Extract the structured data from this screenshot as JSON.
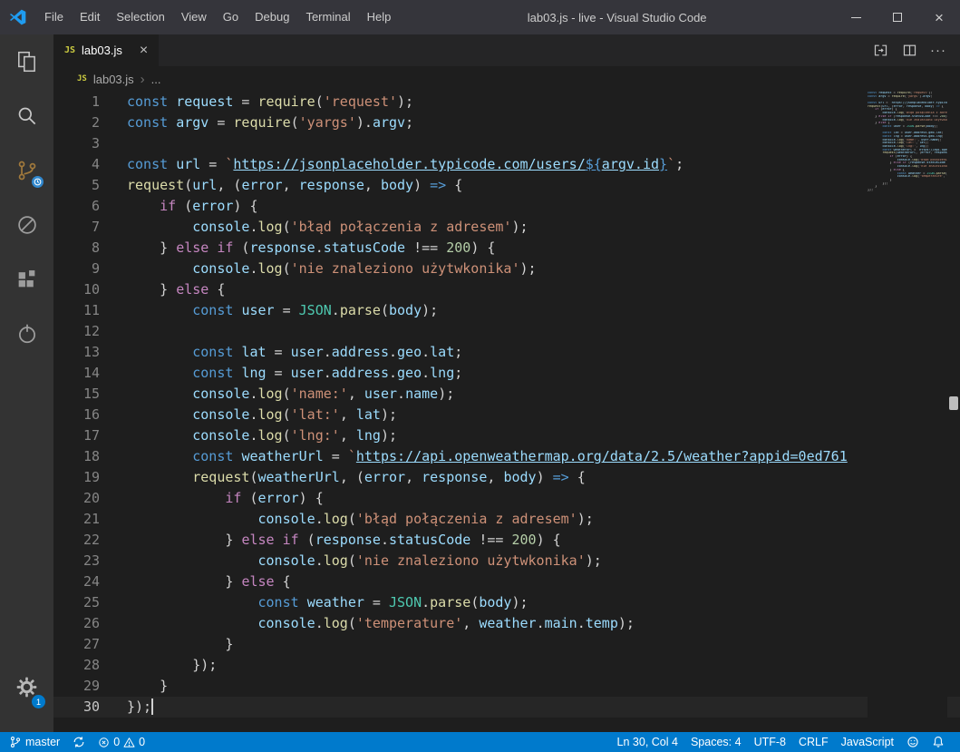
{
  "window": {
    "title": "lab03.js - live - Visual Studio Code",
    "menus": [
      "File",
      "Edit",
      "Selection",
      "View",
      "Go",
      "Debug",
      "Terminal",
      "Help"
    ],
    "close_glyph": "×"
  },
  "activity_bar": {
    "items": [
      "explorer",
      "search",
      "source-control",
      "debug",
      "extensions",
      "extension"
    ],
    "settings_badge": "1"
  },
  "tabs": [
    {
      "icon": "JS",
      "label": "lab03.js",
      "close": "×",
      "active": true
    }
  ],
  "editor_actions": {
    "more": "···"
  },
  "breadcrumb": {
    "icon": "JS",
    "file": "lab03.js",
    "separator": "›",
    "symbol": "..."
  },
  "editor": {
    "cursor": {
      "line": 30,
      "col": 4
    },
    "lines": [
      [
        [
          "kw",
          "const"
        ],
        [
          "pl",
          " "
        ],
        [
          "var",
          "request"
        ],
        [
          "pl",
          " = "
        ],
        [
          "fn",
          "require"
        ],
        [
          "pl",
          "("
        ],
        [
          "str",
          "'request'"
        ],
        [
          "pl",
          ");"
        ]
      ],
      [
        [
          "kw",
          "const"
        ],
        [
          "pl",
          " "
        ],
        [
          "var",
          "argv"
        ],
        [
          "pl",
          " = "
        ],
        [
          "fn",
          "require"
        ],
        [
          "pl",
          "("
        ],
        [
          "str",
          "'yargs'"
        ],
        [
          "pl",
          ")."
        ],
        [
          "var",
          "argv"
        ],
        [
          "pl",
          ";"
        ]
      ],
      [],
      [
        [
          "kw",
          "const"
        ],
        [
          "pl",
          " "
        ],
        [
          "var",
          "url"
        ],
        [
          "pl",
          " = "
        ],
        [
          "str",
          "`"
        ],
        [
          "link u",
          "https://jsonplaceholder.typicode.com/users/"
        ],
        [
          "kw u",
          "${"
        ],
        [
          "var u",
          "argv.id"
        ],
        [
          "kw u",
          "}"
        ],
        [
          "str",
          "`"
        ],
        [
          "pl",
          ";"
        ]
      ],
      [
        [
          "fn",
          "request"
        ],
        [
          "pl",
          "("
        ],
        [
          "var",
          "url"
        ],
        [
          "pl",
          ", ("
        ],
        [
          "var",
          "error"
        ],
        [
          "pl",
          ", "
        ],
        [
          "var",
          "response"
        ],
        [
          "pl",
          ", "
        ],
        [
          "var",
          "body"
        ],
        [
          "pl",
          ") "
        ],
        [
          "kw",
          "=>"
        ],
        [
          "pl",
          " {"
        ]
      ],
      [
        [
          "pl",
          "    "
        ],
        [
          "ctrl",
          "if"
        ],
        [
          "pl",
          " ("
        ],
        [
          "var",
          "error"
        ],
        [
          "pl",
          ") {"
        ]
      ],
      [
        [
          "pl",
          "        "
        ],
        [
          "var",
          "console"
        ],
        [
          "pl",
          "."
        ],
        [
          "fn",
          "log"
        ],
        [
          "pl",
          "("
        ],
        [
          "str",
          "'błąd połączenia z adresem'"
        ],
        [
          "pl",
          ");"
        ]
      ],
      [
        [
          "pl",
          "    } "
        ],
        [
          "ctrl",
          "else"
        ],
        [
          "pl",
          " "
        ],
        [
          "ctrl",
          "if"
        ],
        [
          "pl",
          " ("
        ],
        [
          "var",
          "response"
        ],
        [
          "pl",
          "."
        ],
        [
          "var",
          "statusCode"
        ],
        [
          "pl",
          " !== "
        ],
        [
          "num",
          "200"
        ],
        [
          "pl",
          ") {"
        ]
      ],
      [
        [
          "pl",
          "        "
        ],
        [
          "var",
          "console"
        ],
        [
          "pl",
          "."
        ],
        [
          "fn",
          "log"
        ],
        [
          "pl",
          "("
        ],
        [
          "str",
          "'nie znaleziono użytwkonika'"
        ],
        [
          "pl",
          ");"
        ]
      ],
      [
        [
          "pl",
          "    } "
        ],
        [
          "ctrl",
          "else"
        ],
        [
          "pl",
          " {"
        ]
      ],
      [
        [
          "pl",
          "        "
        ],
        [
          "kw",
          "const"
        ],
        [
          "pl",
          " "
        ],
        [
          "var",
          "user"
        ],
        [
          "pl",
          " = "
        ],
        [
          "cls",
          "JSON"
        ],
        [
          "pl",
          "."
        ],
        [
          "fn",
          "parse"
        ],
        [
          "pl",
          "("
        ],
        [
          "var",
          "body"
        ],
        [
          "pl",
          ");"
        ]
      ],
      [],
      [
        [
          "pl",
          "        "
        ],
        [
          "kw",
          "const"
        ],
        [
          "pl",
          " "
        ],
        [
          "var",
          "lat"
        ],
        [
          "pl",
          " = "
        ],
        [
          "var",
          "user"
        ],
        [
          "pl",
          "."
        ],
        [
          "var",
          "address"
        ],
        [
          "pl",
          "."
        ],
        [
          "var",
          "geo"
        ],
        [
          "pl",
          "."
        ],
        [
          "var",
          "lat"
        ],
        [
          "pl",
          ";"
        ]
      ],
      [
        [
          "pl",
          "        "
        ],
        [
          "kw",
          "const"
        ],
        [
          "pl",
          " "
        ],
        [
          "var",
          "lng"
        ],
        [
          "pl",
          " = "
        ],
        [
          "var",
          "user"
        ],
        [
          "pl",
          "."
        ],
        [
          "var",
          "address"
        ],
        [
          "pl",
          "."
        ],
        [
          "var",
          "geo"
        ],
        [
          "pl",
          "."
        ],
        [
          "var",
          "lng"
        ],
        [
          "pl",
          ";"
        ]
      ],
      [
        [
          "pl",
          "        "
        ],
        [
          "var",
          "console"
        ],
        [
          "pl",
          "."
        ],
        [
          "fn",
          "log"
        ],
        [
          "pl",
          "("
        ],
        [
          "str",
          "'name:'"
        ],
        [
          "pl",
          ", "
        ],
        [
          "var",
          "user"
        ],
        [
          "pl",
          "."
        ],
        [
          "var",
          "name"
        ],
        [
          "pl",
          ");"
        ]
      ],
      [
        [
          "pl",
          "        "
        ],
        [
          "var",
          "console"
        ],
        [
          "pl",
          "."
        ],
        [
          "fn",
          "log"
        ],
        [
          "pl",
          "("
        ],
        [
          "str",
          "'lat:'"
        ],
        [
          "pl",
          ", "
        ],
        [
          "var",
          "lat"
        ],
        [
          "pl",
          ");"
        ]
      ],
      [
        [
          "pl",
          "        "
        ],
        [
          "var",
          "console"
        ],
        [
          "pl",
          "."
        ],
        [
          "fn",
          "log"
        ],
        [
          "pl",
          "("
        ],
        [
          "str",
          "'lng:'"
        ],
        [
          "pl",
          ", "
        ],
        [
          "var",
          "lng"
        ],
        [
          "pl",
          ");"
        ]
      ],
      [
        [
          "pl",
          "        "
        ],
        [
          "kw",
          "const"
        ],
        [
          "pl",
          " "
        ],
        [
          "var",
          "weatherUrl"
        ],
        [
          "pl",
          " = "
        ],
        [
          "str",
          "`"
        ],
        [
          "link u",
          "https://api.openweathermap.org/data/2.5/weather?appid=0ed761"
        ]
      ],
      [
        [
          "pl",
          "        "
        ],
        [
          "fn",
          "request"
        ],
        [
          "pl",
          "("
        ],
        [
          "var",
          "weatherUrl"
        ],
        [
          "pl",
          ", ("
        ],
        [
          "var",
          "error"
        ],
        [
          "pl",
          ", "
        ],
        [
          "var",
          "response"
        ],
        [
          "pl",
          ", "
        ],
        [
          "var",
          "body"
        ],
        [
          "pl",
          ") "
        ],
        [
          "kw",
          "=>"
        ],
        [
          "pl",
          " {"
        ]
      ],
      [
        [
          "pl",
          "            "
        ],
        [
          "ctrl",
          "if"
        ],
        [
          "pl",
          " ("
        ],
        [
          "var",
          "error"
        ],
        [
          "pl",
          ") {"
        ]
      ],
      [
        [
          "pl",
          "                "
        ],
        [
          "var",
          "console"
        ],
        [
          "pl",
          "."
        ],
        [
          "fn",
          "log"
        ],
        [
          "pl",
          "("
        ],
        [
          "str",
          "'błąd połączenia z adresem'"
        ],
        [
          "pl",
          ");"
        ]
      ],
      [
        [
          "pl",
          "            } "
        ],
        [
          "ctrl",
          "else"
        ],
        [
          "pl",
          " "
        ],
        [
          "ctrl",
          "if"
        ],
        [
          "pl",
          " ("
        ],
        [
          "var",
          "response"
        ],
        [
          "pl",
          "."
        ],
        [
          "var",
          "statusCode"
        ],
        [
          "pl",
          " !== "
        ],
        [
          "num",
          "200"
        ],
        [
          "pl",
          ") {"
        ]
      ],
      [
        [
          "pl",
          "                "
        ],
        [
          "var",
          "console"
        ],
        [
          "pl",
          "."
        ],
        [
          "fn",
          "log"
        ],
        [
          "pl",
          "("
        ],
        [
          "str",
          "'nie znaleziono użytwkonika'"
        ],
        [
          "pl",
          ");"
        ]
      ],
      [
        [
          "pl",
          "            } "
        ],
        [
          "ctrl",
          "else"
        ],
        [
          "pl",
          " {"
        ]
      ],
      [
        [
          "pl",
          "                "
        ],
        [
          "kw",
          "const"
        ],
        [
          "pl",
          " "
        ],
        [
          "var",
          "weather"
        ],
        [
          "pl",
          " = "
        ],
        [
          "cls",
          "JSON"
        ],
        [
          "pl",
          "."
        ],
        [
          "fn",
          "parse"
        ],
        [
          "pl",
          "("
        ],
        [
          "var",
          "body"
        ],
        [
          "pl",
          ");"
        ]
      ],
      [
        [
          "pl",
          "                "
        ],
        [
          "var",
          "console"
        ],
        [
          "pl",
          "."
        ],
        [
          "fn",
          "log"
        ],
        [
          "pl",
          "("
        ],
        [
          "str",
          "'temperature'"
        ],
        [
          "pl",
          ", "
        ],
        [
          "var",
          "weather"
        ],
        [
          "pl",
          "."
        ],
        [
          "var",
          "main"
        ],
        [
          "pl",
          "."
        ],
        [
          "var",
          "temp"
        ],
        [
          "pl",
          ");"
        ]
      ],
      [
        [
          "pl",
          "            }"
        ]
      ],
      [
        [
          "pl",
          "        });"
        ]
      ],
      [
        [
          "pl",
          "    }"
        ]
      ],
      [
        [
          "pl",
          "});"
        ]
      ]
    ]
  },
  "status_bar": {
    "branch": "master",
    "errors": "0",
    "warnings": "0",
    "cursor_position": "Ln 30, Col 4",
    "indentation": "Spaces: 4",
    "encoding": "UTF-8",
    "eol": "CRLF",
    "language": "JavaScript"
  },
  "colors": {
    "status_bar": "#007acc",
    "activity_bar": "#333333",
    "editor_background": "#1e1e1e",
    "tab_bar": "#252526",
    "title_bar": "#35353b",
    "accent_badge": "#007acc",
    "syntax": {
      "keyword": "#569cd6",
      "control": "#c586c0",
      "variable": "#9cdcfe",
      "function": "#dcdcaa",
      "string": "#ce9178",
      "number": "#b5cea8",
      "class": "#4ec9b0",
      "punctuation": "#d4d4d4"
    }
  }
}
